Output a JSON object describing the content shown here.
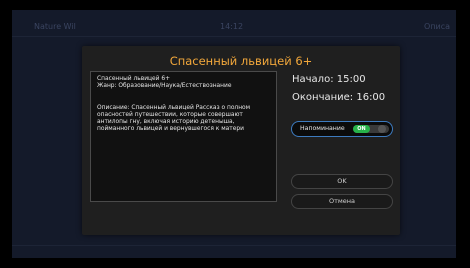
{
  "background": {
    "left_text": "Nature Wil",
    "center_text": "14:12",
    "right_text": "Описа"
  },
  "dialog": {
    "title": "Спасенный львицей 6+",
    "description_lines": [
      "Спасенный львицей 6+",
      "Жанр: Образование/Наука/Естествознание"
    ],
    "description_body": [
      "Описание: Спасенный львицей Рассказ о полном",
      "опасностей путешествии, которые совершают",
      "антилопы гну, включая историю детеныша,",
      "пойманного львицей и вернувшегося к матери"
    ],
    "start_label": "Начало: 15:00",
    "end_label": "Окончание: 16:00",
    "reminder": {
      "label": "Напоминание",
      "state": "ON"
    },
    "buttons": {
      "ok": "OK",
      "cancel": "Отмена"
    }
  },
  "colors": {
    "accent_title": "#f3a83b",
    "toggle_on": "#27b24a",
    "reminder_border": "#3d7bbf"
  }
}
